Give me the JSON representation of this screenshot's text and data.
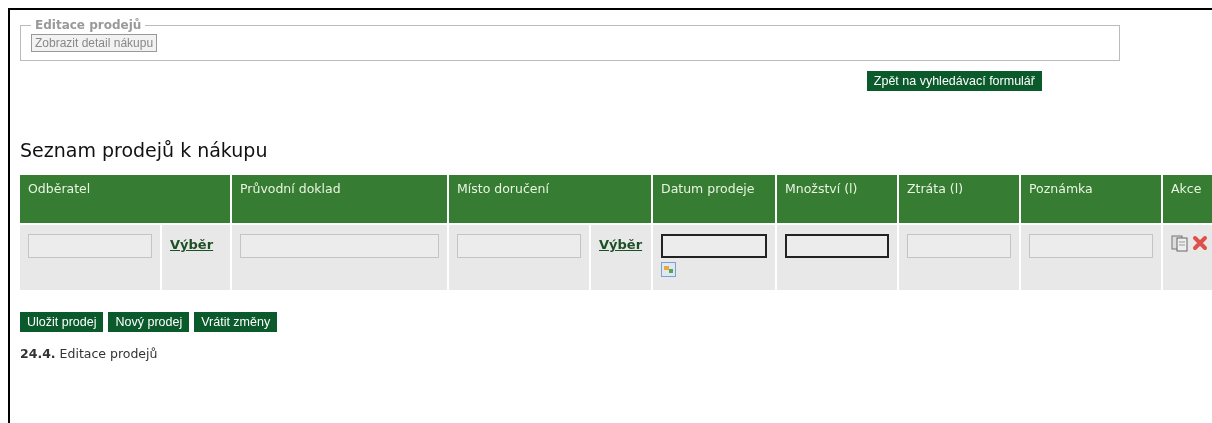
{
  "fieldset": {
    "legend": "Editace prodejů",
    "button": "Zobrazit detail nákupu"
  },
  "back_button": "Zpět na vyhledávací formulář",
  "heading": "Seznam prodejů k nákupu",
  "table": {
    "columns": [
      {
        "label": "Odběratel",
        "cells": [
          {
            "kind": "input",
            "required": false
          },
          {
            "kind": "link",
            "text": "Výběr"
          }
        ]
      },
      {
        "label": "Průvodní doklad",
        "cells": [
          {
            "kind": "input",
            "required": false
          }
        ]
      },
      {
        "label": "Místo doručení",
        "cells": [
          {
            "kind": "input",
            "required": false
          },
          {
            "kind": "link",
            "text": "Výběr"
          }
        ]
      },
      {
        "label": "Datum prodeje",
        "cells": [
          {
            "kind": "date",
            "required": true
          }
        ]
      },
      {
        "label": "Množství (l)",
        "cells": [
          {
            "kind": "input",
            "required": true
          }
        ]
      },
      {
        "label": "Ztráta (l)",
        "cells": [
          {
            "kind": "input",
            "required": false
          }
        ]
      },
      {
        "label": "Poznámka",
        "cells": [
          {
            "kind": "input",
            "required": false
          }
        ]
      },
      {
        "label": "Akce",
        "cells": [
          {
            "kind": "actions"
          }
        ]
      }
    ]
  },
  "buttons": [
    "Uložit prodej",
    "Nový prodej",
    "Vrátit změny"
  ],
  "footer": {
    "number": "24.4.",
    "text": "Editace prodejů"
  }
}
